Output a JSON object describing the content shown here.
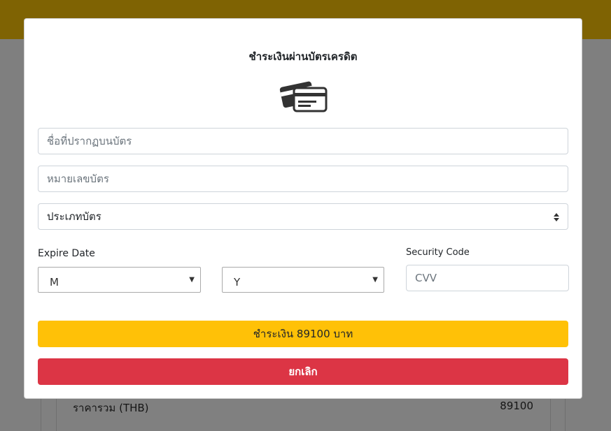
{
  "background": {
    "total_label": "ราคารวม (THB)",
    "total_value": "89100"
  },
  "modal": {
    "title": "ชำระเงินผ่านบัตรเครดิต",
    "icon": "credit-cards-icon",
    "card_name_placeholder": "ชื่อที่ปรากฏบนบัตร",
    "card_number_placeholder": "หมายเลขบัตร",
    "card_type_value": "ประเภทบัตร",
    "expire_label": "Expire Date",
    "month_value": "M",
    "year_value": "Y",
    "security_label": "Security Code",
    "cvv_placeholder": "CVV",
    "pay_button": "ชำระเงิน 89100 บาท",
    "cancel_button": "ยกเลิก"
  },
  "colors": {
    "topbar": "#7f6303",
    "pay": "#ffc107",
    "cancel": "#dc3545"
  }
}
